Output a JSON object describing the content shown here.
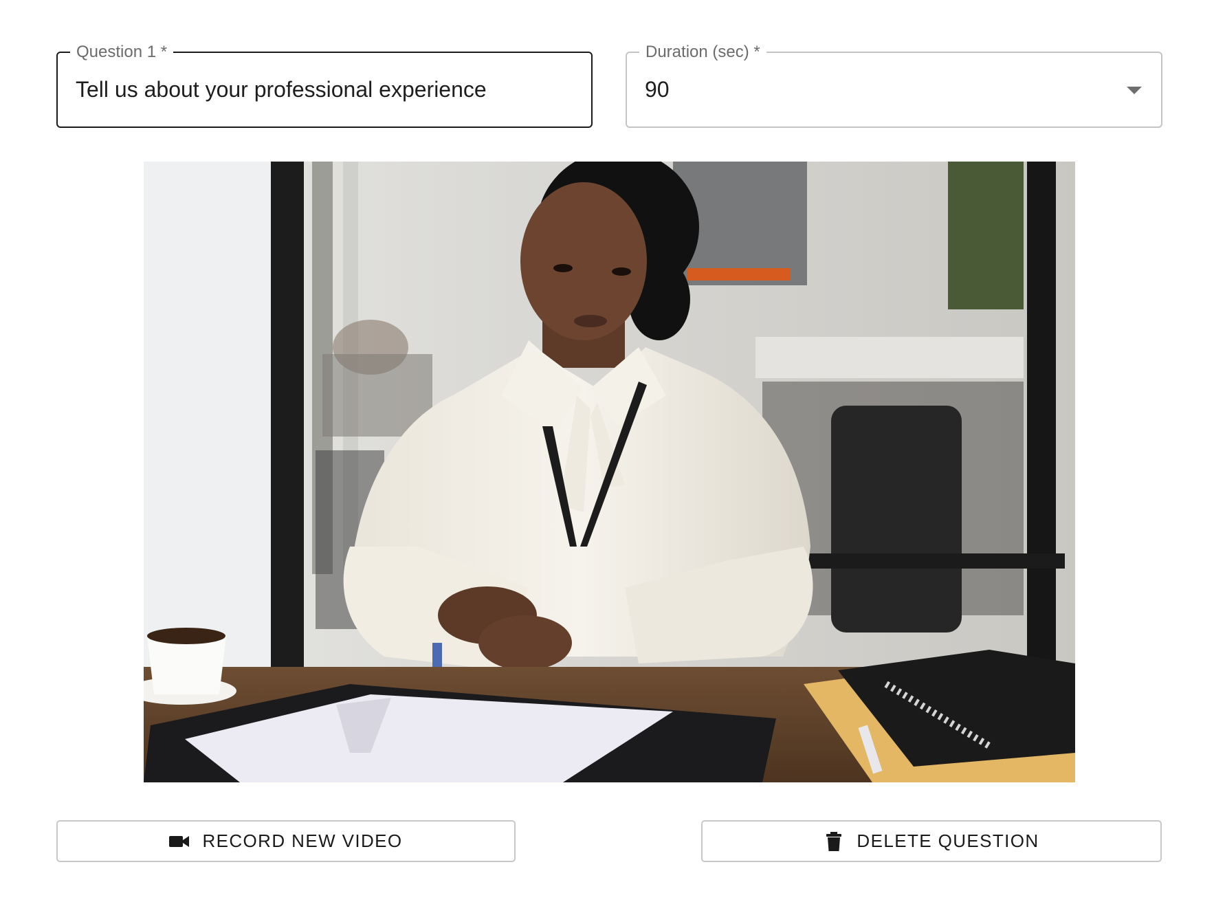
{
  "question_field": {
    "label": "Question 1 *",
    "value": "Tell us about your professional experience"
  },
  "duration_field": {
    "label": "Duration (sec) *",
    "value": "90"
  },
  "video": {
    "description_icon": "video-preview"
  },
  "actions": {
    "record_label": "RECORD NEW VIDEO",
    "record_icon": "videocam-icon",
    "delete_label": "DELETE QUESTION",
    "delete_icon": "trash-icon"
  }
}
